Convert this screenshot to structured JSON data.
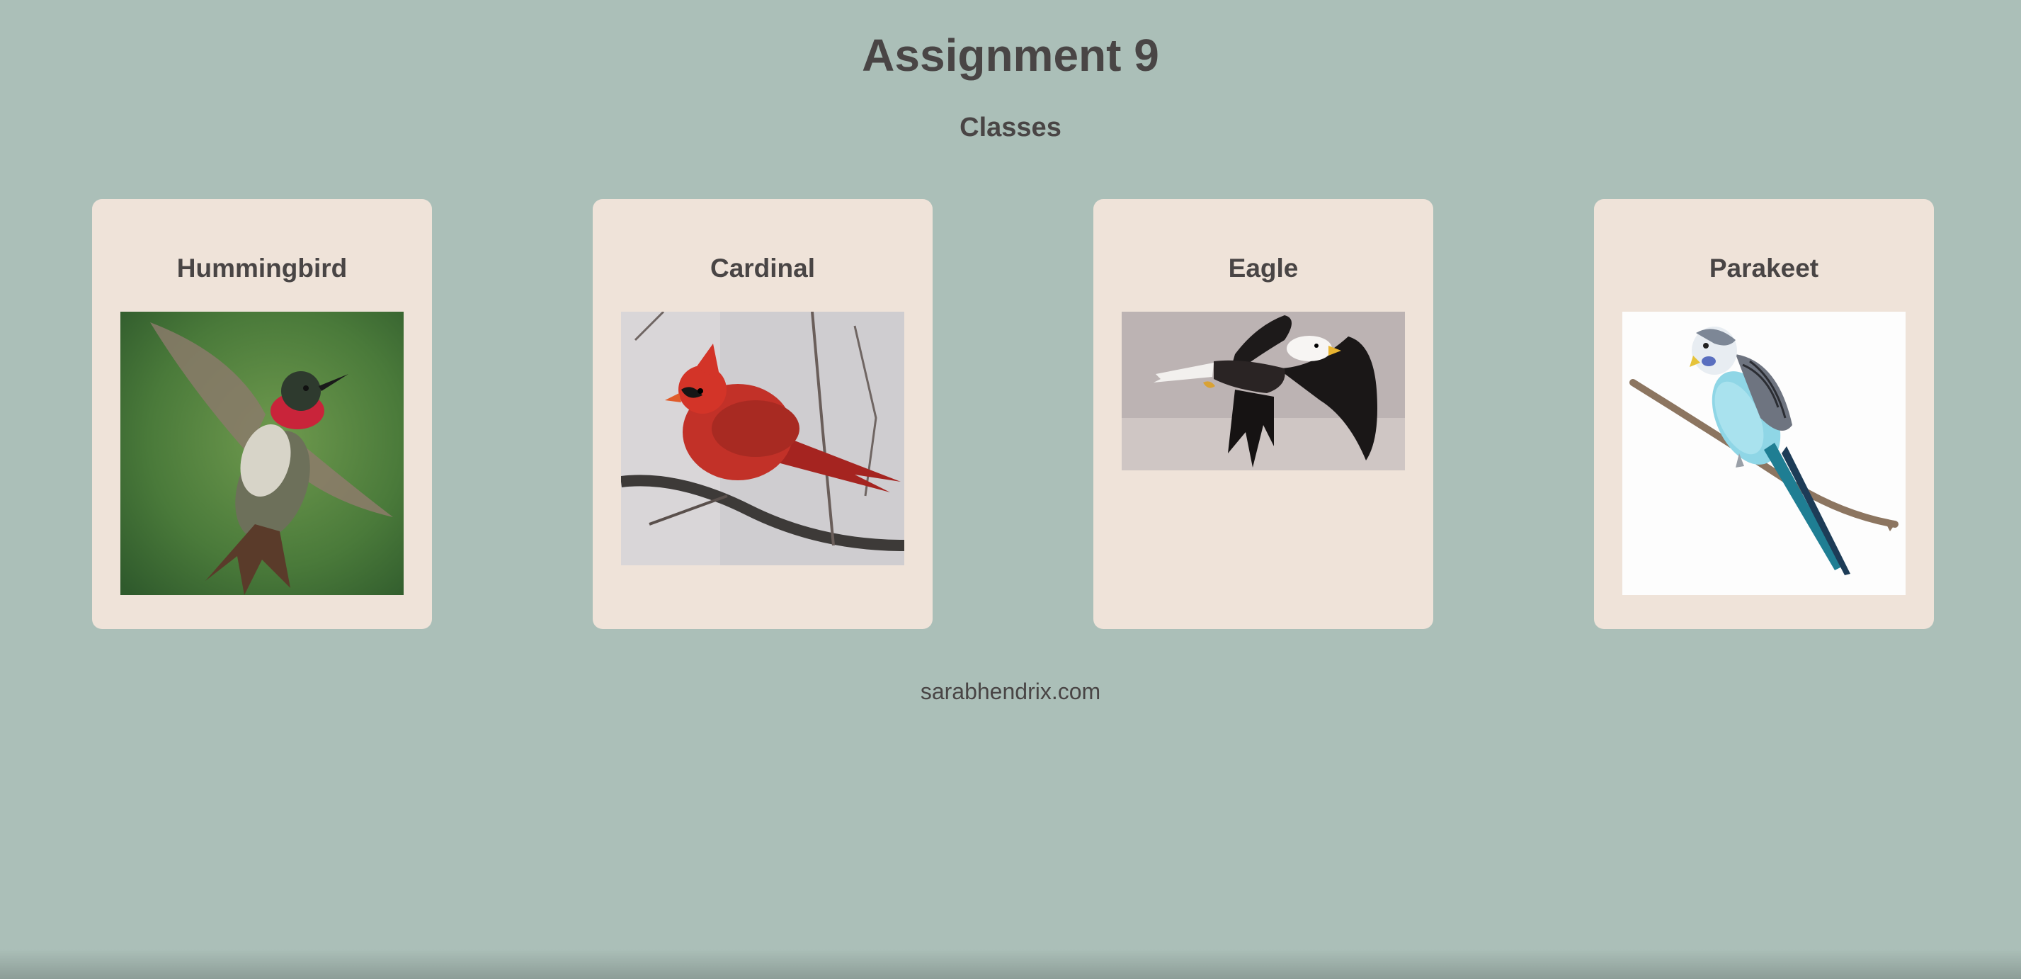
{
  "header": {
    "title": "Assignment 9",
    "subtitle": "Classes"
  },
  "cards": [
    {
      "title": "Hummingbird"
    },
    {
      "title": "Cardinal"
    },
    {
      "title": "Eagle"
    },
    {
      "title": "Parakeet"
    }
  ],
  "footer": {
    "link_text": "sarabhendrix.com"
  }
}
